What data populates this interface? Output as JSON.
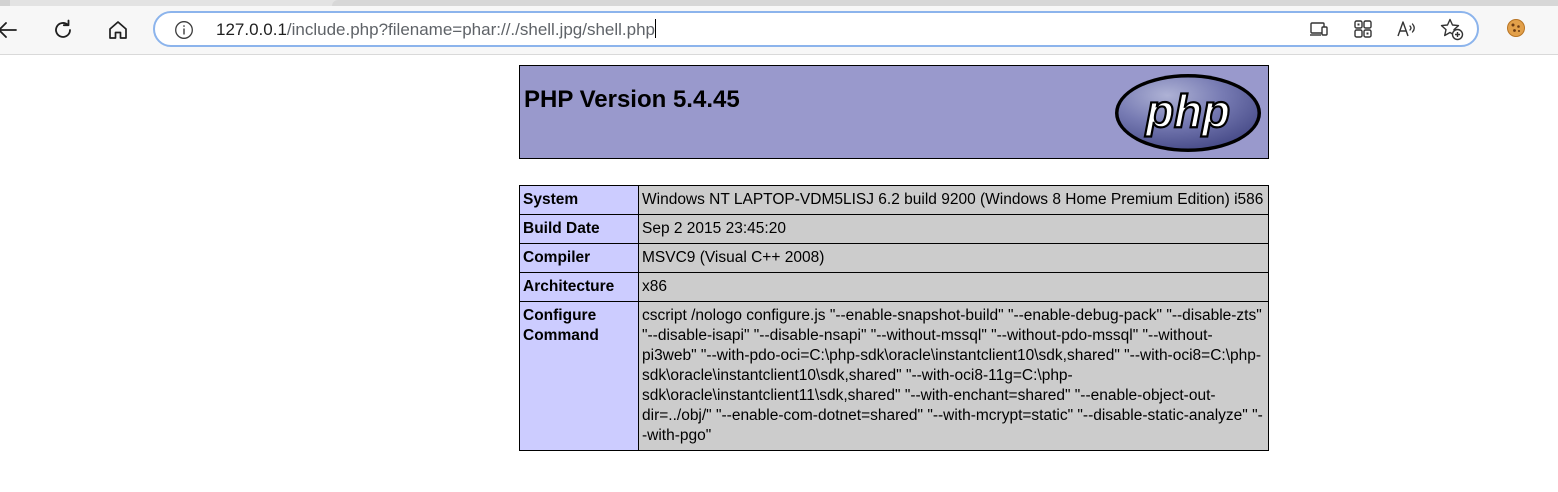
{
  "browser": {
    "url_host": "127.0.0.1",
    "url_rest": "/include.php?filename=phar://./shell.jpg/shell.php",
    "icons": {
      "back": "arrow-left-icon",
      "refresh": "refresh-icon",
      "home": "home-icon",
      "site_info": "info-icon",
      "cast": "cast-icon",
      "apps": "apps-icon",
      "read_aloud": "read-aloud-icon",
      "favorite": "add-favorite-icon",
      "profile": "cookie-icon"
    }
  },
  "phpinfo": {
    "title": "PHP Version 5.4.45",
    "logo_text": "php",
    "colors": {
      "header_bg": "#9999cc",
      "key_bg": "#ccccff",
      "value_bg": "#cccccc"
    },
    "rows": [
      {
        "key": "System",
        "value": "Windows NT LAPTOP-VDM5LISJ 6.2 build 9200 (Windows 8 Home Premium Edition) i586"
      },
      {
        "key": "Build Date",
        "value": "Sep 2 2015 23:45:20"
      },
      {
        "key": "Compiler",
        "value": "MSVC9 (Visual C++ 2008)"
      },
      {
        "key": "Architecture",
        "value": "x86"
      },
      {
        "key": "Configure Command",
        "value": "cscript /nologo configure.js \"--enable-snapshot-build\" \"--enable-debug-pack\" \"--disable-zts\" \"--disable-isapi\" \"--disable-nsapi\" \"--without-mssql\" \"--without-pdo-mssql\" \"--without-pi3web\" \"--with-pdo-oci=C:\\php-sdk\\oracle\\instantclient10\\sdk,shared\" \"--with-oci8=C:\\php-sdk\\oracle\\instantclient10\\sdk,shared\" \"--with-oci8-11g=C:\\php-sdk\\oracle\\instantclient11\\sdk,shared\" \"--with-enchant=shared\" \"--enable-object-out-dir=../obj/\" \"--enable-com-dotnet=shared\" \"--with-mcrypt=static\" \"--disable-static-analyze\" \"--with-pgo\""
      }
    ]
  }
}
